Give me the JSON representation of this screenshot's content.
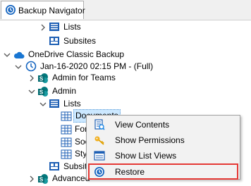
{
  "tab": {
    "title": "Backup Navigator"
  },
  "tree": {
    "items": [
      {
        "label": "Lists"
      },
      {
        "label": "Subsites"
      },
      {
        "label": "OneDrive Classic Backup"
      },
      {
        "label": "Jan-16-2020 02:15 PM - (Full)"
      },
      {
        "label": "Admin for Teams"
      },
      {
        "label": "Admin"
      },
      {
        "label": "Lists"
      },
      {
        "label": "Documents"
      },
      {
        "label": "Forr"
      },
      {
        "label": "Soci"
      },
      {
        "label": "Styl"
      },
      {
        "label": "Subsite"
      },
      {
        "label": "Advanced"
      }
    ]
  },
  "context_menu": {
    "items": [
      {
        "label": "View Contents",
        "icon": "view-contents-icon"
      },
      {
        "label": "Show Permissions",
        "icon": "key-icon"
      },
      {
        "label": "Show List Views",
        "icon": "list-views-icon"
      },
      {
        "label": "Restore",
        "icon": "restore-icon"
      }
    ]
  },
  "colors": {
    "selection": "#cce8ff",
    "highlight": "#e53935",
    "sharepoint_teal": "#038387",
    "folder_blue": "#1e5fb4",
    "cloud_blue": "#1976d2"
  }
}
